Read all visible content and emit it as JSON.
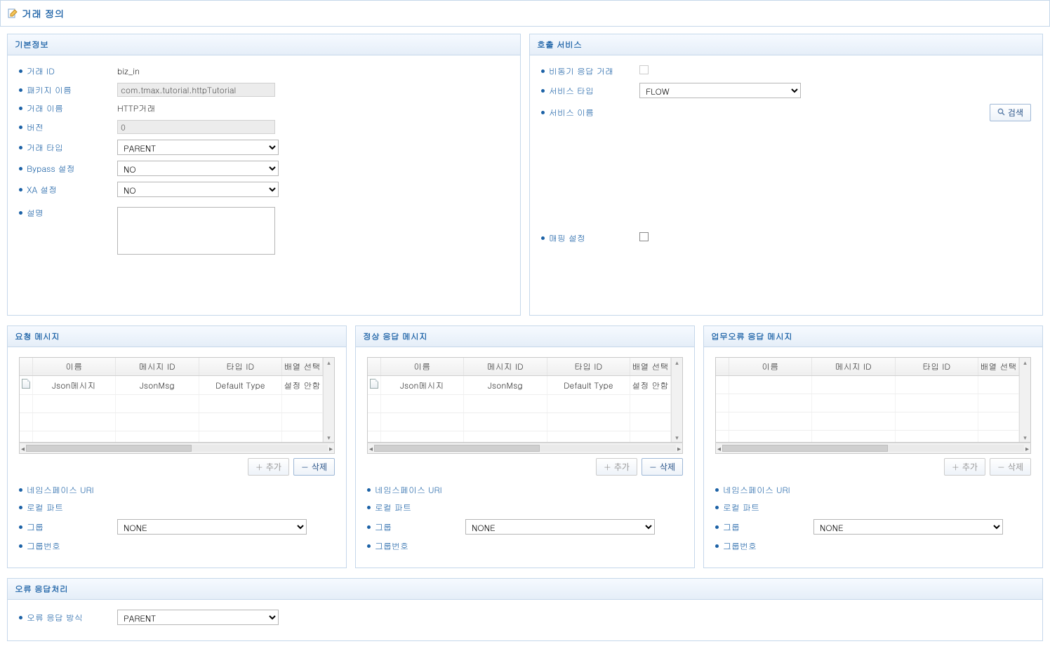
{
  "page": {
    "title": "거래 정의"
  },
  "basic": {
    "header": "기본정보",
    "labels": {
      "txnId": "거래 ID",
      "pkgName": "패키지 이름",
      "txnName": "거래 이름",
      "version": "버전",
      "txnType": "거래 타입",
      "bypass": "Bypass 설정",
      "xa": "XA 설정",
      "desc": "설명"
    },
    "values": {
      "txnId": "biz_in",
      "pkgName": "com.tmax.tutorial.httpTutorial",
      "txnName": "HTTP거래",
      "version": "0",
      "txnType": "PARENT",
      "bypass": "NO",
      "xa": "NO",
      "desc": ""
    }
  },
  "call": {
    "header": "호출 서비스",
    "labels": {
      "asyncResp": "비동기 응답 거래",
      "svcType": "서비스 타입",
      "svcName": "서비스 이름",
      "mapSetting": "매핑 설정"
    },
    "values": {
      "svcType": "FLOW"
    },
    "buttons": {
      "search": "검색"
    }
  },
  "msg": {
    "req": {
      "header": "요청 메시지"
    },
    "ok": {
      "header": "정상 응답 메시지"
    },
    "bizerr": {
      "header": "업무오류 응답 메시지"
    },
    "cols": {
      "name": "이름",
      "msgId": "메시지 ID",
      "typeId": "타입 ID",
      "arrSel": "배열 선택"
    },
    "rowCells": {
      "arrSelNotSet": "설정 안함"
    },
    "reqRows": [
      {
        "name": "Json메시지",
        "msgId": "JsonMsg",
        "typeId": "Default Type"
      }
    ],
    "okRows": [
      {
        "name": "Json메시지",
        "msgId": "JsonMsg",
        "typeId": "Default Type"
      }
    ],
    "bizerrRows": [],
    "buttons": {
      "add": "추가",
      "del": "삭제"
    },
    "subLabels": {
      "nsUri": "네임스페이스 URI",
      "localPart": "로컬 파트",
      "group": "그룹",
      "groupNo": "그룹번호"
    },
    "subValues": {
      "group": "NONE"
    }
  },
  "err": {
    "header": "오류 응답처리",
    "labels": {
      "mode": "오류 응답 방식"
    },
    "values": {
      "mode": "PARENT"
    }
  }
}
